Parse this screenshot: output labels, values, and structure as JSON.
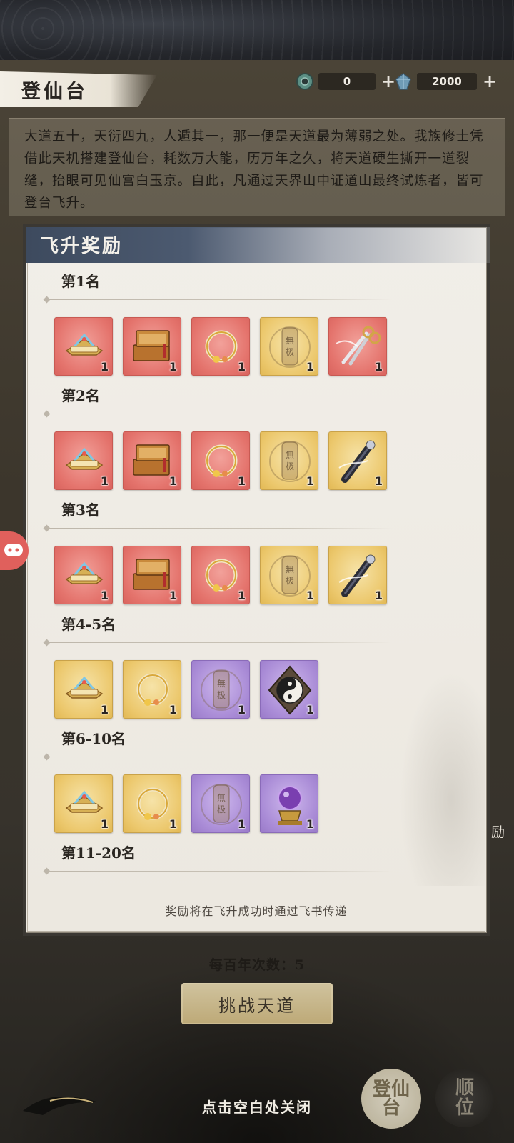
{
  "header": {
    "title": "登仙台",
    "currency1": {
      "value": "0",
      "icon": "jade-coin-icon"
    },
    "currency2": {
      "value": "2000",
      "icon": "spirit-stone-icon"
    },
    "plus": "+"
  },
  "description": "大道五十，天衍四九，人遁其一，那一便是天道最为薄弱之处。我族修士凭借此天机搭建登仙台，耗数万大能，历万年之久，将天道硬生撕开一道裂缝，抬眼可见仙宫白玉京。自此，凡通过天界山中证道山最终试炼者，皆可登台飞升。",
  "panel": {
    "title": "飞升奖励",
    "tiers": [
      {
        "label": "第1名",
        "items": [
          {
            "name": "title-badge-icon",
            "bg": "red",
            "qty": "1"
          },
          {
            "name": "treasure-chest-icon",
            "bg": "red",
            "qty": "1"
          },
          {
            "name": "ring-icon",
            "bg": "red",
            "qty": "1"
          },
          {
            "name": "wuji-token-icon",
            "bg": "gold",
            "qty": "1"
          },
          {
            "name": "scissors-icon",
            "bg": "red",
            "qty": "1"
          }
        ]
      },
      {
        "label": "第2名",
        "items": [
          {
            "name": "title-badge-icon",
            "bg": "red",
            "qty": "1"
          },
          {
            "name": "treasure-chest-icon",
            "bg": "red",
            "qty": "1"
          },
          {
            "name": "ring-icon",
            "bg": "red",
            "qty": "1"
          },
          {
            "name": "wuji-token-icon",
            "bg": "gold",
            "qty": "1"
          },
          {
            "name": "flute-icon",
            "bg": "gold",
            "qty": "1"
          }
        ]
      },
      {
        "label": "第3名",
        "items": [
          {
            "name": "title-badge-icon",
            "bg": "red",
            "qty": "1"
          },
          {
            "name": "treasure-chest-icon",
            "bg": "red",
            "qty": "1"
          },
          {
            "name": "ring-icon",
            "bg": "red",
            "qty": "1"
          },
          {
            "name": "wuji-token-icon",
            "bg": "gold",
            "qty": "1"
          },
          {
            "name": "flute-icon",
            "bg": "gold",
            "qty": "1"
          }
        ]
      },
      {
        "label": "第4-5名",
        "items": [
          {
            "name": "title-badge-icon",
            "bg": "gold",
            "qty": "1"
          },
          {
            "name": "ring-icon",
            "bg": "gold",
            "qty": "1"
          },
          {
            "name": "wuji-token-icon",
            "bg": "purple",
            "qty": "1"
          },
          {
            "name": "yin-yang-icon",
            "bg": "purple",
            "qty": "1"
          }
        ]
      },
      {
        "label": "第6-10名",
        "items": [
          {
            "name": "title-badge-icon",
            "bg": "gold",
            "qty": "1"
          },
          {
            "name": "ring-icon",
            "bg": "gold",
            "qty": "1"
          },
          {
            "name": "wuji-token-icon",
            "bg": "purple",
            "qty": "1"
          },
          {
            "name": "crystal-orb-icon",
            "bg": "purple",
            "qty": "1"
          }
        ]
      },
      {
        "label": "第11-20名",
        "items": []
      }
    ],
    "notice": "奖励将在飞升成功时通过飞书传递"
  },
  "footer": {
    "attempts": "每百年次数：5",
    "challenge_button": "挑战天道",
    "close_hint": "点击空白处关闭",
    "btn_dengxiantai": "登仙台",
    "btn_shunwei": "顺位",
    "side_text": "励"
  }
}
